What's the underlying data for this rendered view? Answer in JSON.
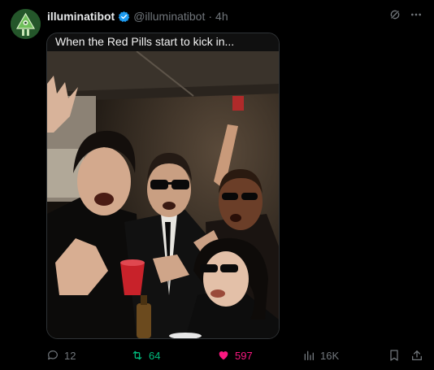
{
  "post": {
    "display_name": "illuminatibot",
    "handle": "@illuminatibot",
    "separator": "·",
    "time": "4h",
    "verified": true,
    "media_caption": "When the Red Pills start to kick in..."
  },
  "actions": {
    "replies": "12",
    "reposts": "64",
    "likes": "597",
    "views": "16K"
  },
  "colors": {
    "background": "#000000",
    "text": "#e7e9ea",
    "muted": "#71767b",
    "verified": "#1d9bf0",
    "repost": "#00ba7c",
    "like": "#f91880"
  },
  "icons": {
    "verified": "verified-badge-icon",
    "grok": "grok-icon",
    "more": "more-icon",
    "reply": "reply-icon",
    "repost": "repost-icon",
    "like": "heart-icon",
    "views": "views-icon",
    "bookmark": "bookmark-icon",
    "share": "share-icon"
  }
}
